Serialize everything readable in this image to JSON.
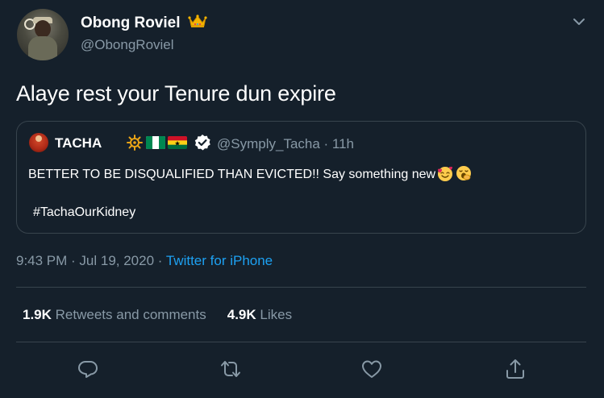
{
  "author": {
    "display_name": "Obong Roviel",
    "handle": "@ObongRoviel",
    "badge_icon": "crown-emoji"
  },
  "tweet": {
    "text": "Alaye rest your Tenure dun expire"
  },
  "quoted": {
    "display_name": "TACHA",
    "handle_time": "@Symply_Tacha · 11h",
    "flags": [
      "ship-wheel-emoji",
      "nigeria-flag",
      "ghana-flag"
    ],
    "verified": true,
    "text": "BETTER TO BE DISQUALIFIED THAN EVICTED!! Say something new",
    "text_emojis": [
      "smiling-face-with-hearts-emoji",
      "yawning-face-emoji"
    ],
    "hashtag": "#TachaOurKidney"
  },
  "meta": {
    "timestamp": "9:43 PM · Jul 19, 2020 · ",
    "source": "Twitter for iPhone"
  },
  "stats": {
    "retweets_count": "1.9K",
    "retweets_label": "Retweets and comments",
    "likes_count": "4.9K",
    "likes_label": "Likes"
  },
  "actions": [
    "reply-icon",
    "retweet-icon",
    "like-icon",
    "share-icon"
  ],
  "colors": {
    "background": "#15202b",
    "secondary_text": "#8899a6",
    "link": "#1da1f2",
    "border": "#38444d"
  }
}
